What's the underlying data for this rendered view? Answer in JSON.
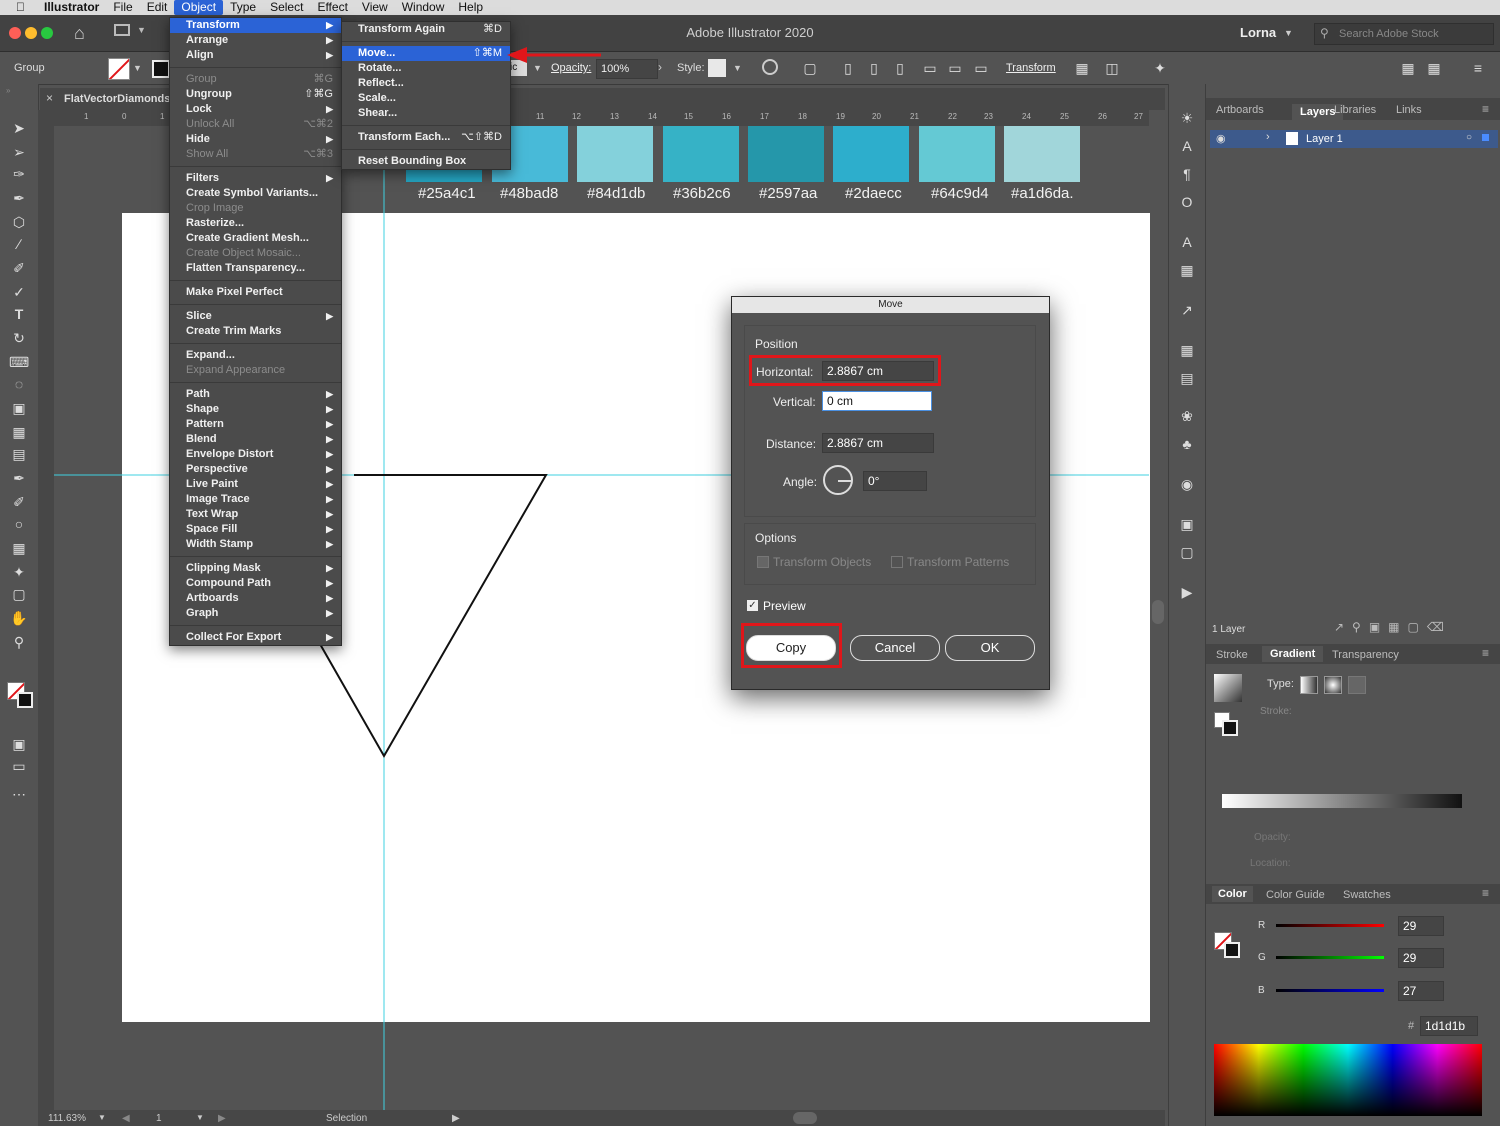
{
  "menubar": {
    "app": "Illustrator",
    "items": [
      "File",
      "Edit",
      "Object",
      "Type",
      "Select",
      "Effect",
      "View",
      "Window",
      "Help"
    ],
    "active": "Object"
  },
  "titlebar": {
    "title": "Adobe Illustrator 2020",
    "user": "Lorna",
    "search_placeholder": "Search Adobe Stock"
  },
  "control_bar": {
    "selection_label": "Group",
    "style_label": "sic",
    "opacity_label": "Opacity:",
    "opacity_value": "100%",
    "style_name_label": "Style:",
    "transform_label": "Transform"
  },
  "document": {
    "tab_name": "FlatVectorDiamonds/"
  },
  "ruler_numbers": [
    "1",
    "0",
    "1",
    "11",
    "12",
    "13",
    "14",
    "15",
    "16",
    "17",
    "18",
    "19",
    "20",
    "21",
    "22",
    "23",
    "24",
    "25",
    "26",
    "27"
  ],
  "swatches": [
    {
      "color": "#25a4c1",
      "label": "#25a4c1"
    },
    {
      "color": "#48bad8",
      "label": "#48bad8"
    },
    {
      "color": "#84d1db",
      "label": "#84d1db"
    },
    {
      "color": "#36b2c6",
      "label": "#36b2c6"
    },
    {
      "color": "#2597aa",
      "label": "#2597aa"
    },
    {
      "color": "#2daecc",
      "label": "#2daecc"
    },
    {
      "color": "#64c9d4",
      "label": "#64c9d4"
    },
    {
      "color": "#a1d6da",
      "label": "#a1d6da."
    }
  ],
  "object_menu": {
    "items": [
      {
        "label": "Transform",
        "submenu": true,
        "highlight": true
      },
      {
        "label": "Arrange",
        "submenu": true
      },
      {
        "label": "Align",
        "submenu": true
      },
      {
        "sep": true
      },
      {
        "label": "Group",
        "shortcut": "⌘G",
        "disabled": true
      },
      {
        "label": "Ungroup",
        "shortcut": "⇧⌘G"
      },
      {
        "label": "Lock",
        "submenu": true
      },
      {
        "label": "Unlock All",
        "shortcut": "⌥⌘2",
        "disabled": true
      },
      {
        "label": "Hide",
        "submenu": true
      },
      {
        "label": "Show All",
        "shortcut": "⌥⌘3",
        "disabled": true
      },
      {
        "sep": true
      },
      {
        "label": "Filters",
        "submenu": true
      },
      {
        "label": "Create Symbol Variants..."
      },
      {
        "label": "Crop Image",
        "disabled": true
      },
      {
        "label": "Rasterize..."
      },
      {
        "label": "Create Gradient Mesh..."
      },
      {
        "label": "Create Object Mosaic...",
        "disabled": true
      },
      {
        "label": "Flatten Transparency..."
      },
      {
        "sep": true
      },
      {
        "label": "Make Pixel Perfect"
      },
      {
        "sep": true
      },
      {
        "label": "Slice",
        "submenu": true
      },
      {
        "label": "Create Trim Marks"
      },
      {
        "sep": true
      },
      {
        "label": "Expand..."
      },
      {
        "label": "Expand Appearance",
        "disabled": true
      },
      {
        "sep": true
      },
      {
        "label": "Path",
        "submenu": true
      },
      {
        "label": "Shape",
        "submenu": true
      },
      {
        "label": "Pattern",
        "submenu": true
      },
      {
        "label": "Blend",
        "submenu": true
      },
      {
        "label": "Envelope Distort",
        "submenu": true
      },
      {
        "label": "Perspective",
        "submenu": true
      },
      {
        "label": "Live Paint",
        "submenu": true
      },
      {
        "label": "Image Trace",
        "submenu": true
      },
      {
        "label": "Text Wrap",
        "submenu": true
      },
      {
        "label": "Space Fill",
        "submenu": true
      },
      {
        "label": "Width Stamp",
        "submenu": true
      },
      {
        "sep": true
      },
      {
        "label": "Clipping Mask",
        "submenu": true
      },
      {
        "label": "Compound Path",
        "submenu": true
      },
      {
        "label": "Artboards",
        "submenu": true
      },
      {
        "label": "Graph",
        "submenu": true
      },
      {
        "sep": true
      },
      {
        "label": "Collect For Export",
        "submenu": true
      }
    ]
  },
  "transform_menu": {
    "items": [
      {
        "label": "Transform Again",
        "shortcut": "⌘D"
      },
      {
        "sep": true
      },
      {
        "label": "Move...",
        "shortcut": "⇧⌘M",
        "highlight": true
      },
      {
        "label": "Rotate..."
      },
      {
        "label": "Reflect..."
      },
      {
        "label": "Scale..."
      },
      {
        "label": "Shear..."
      },
      {
        "sep": true
      },
      {
        "label": "Transform Each...",
        "shortcut": "⌥⇧⌘D"
      },
      {
        "sep": true
      },
      {
        "label": "Reset Bounding Box"
      }
    ]
  },
  "move_dialog": {
    "title": "Move",
    "position_label": "Position",
    "horizontal_label": "Horizontal:",
    "horizontal_value": "2.8867 cm",
    "vertical_label": "Vertical:",
    "vertical_value": "0 cm",
    "distance_label": "Distance:",
    "distance_value": "2.8867 cm",
    "angle_label": "Angle:",
    "angle_value": "0°",
    "options_label": "Options",
    "transform_objects_label": "Transform Objects",
    "transform_patterns_label": "Transform Patterns",
    "preview_label": "Preview",
    "copy_label": "Copy",
    "cancel_label": "Cancel",
    "ok_label": "OK"
  },
  "layers_panel": {
    "tabs": [
      "Artboards",
      "Layers",
      "Libraries",
      "Links"
    ],
    "active_tab": "Layers",
    "layer_name": "Layer 1",
    "count_label": "1 Layer"
  },
  "gradient_panel": {
    "tabs": [
      "Stroke",
      "Gradient",
      "Transparency"
    ],
    "active_tab": "Gradient",
    "type_label": "Type:",
    "stroke_label": "Stroke:",
    "opacity_label": "Opacity:",
    "location_label": "Location:"
  },
  "color_panel": {
    "tabs": [
      "Color",
      "Color Guide",
      "Swatches"
    ],
    "active_tab": "Color",
    "r_label": "R",
    "r_value": "29",
    "g_label": "G",
    "g_value": "29",
    "b_label": "B",
    "b_value": "27",
    "hex_prefix": "#",
    "hex_value": "1d1d1b"
  },
  "statusbar": {
    "zoom": "111.63%",
    "artboard_number": "1",
    "tool": "Selection"
  },
  "colors": {
    "accent": "#2b63d6",
    "highlight_red": "#e0161a",
    "guide": "#3fd0e0"
  }
}
